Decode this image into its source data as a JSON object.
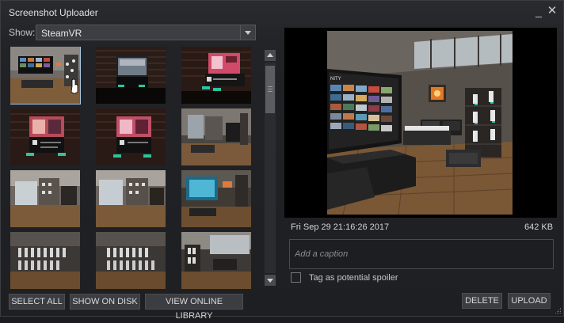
{
  "window": {
    "title": "Screenshot Uploader",
    "minimize_glyph": "_",
    "close_glyph": "✕"
  },
  "filter": {
    "label": "Show:",
    "selected": "SteamVR"
  },
  "buttons": {
    "select_all": "SELECT ALL",
    "show_on_disk": "SHOW ON DISK",
    "view_online_library": "VIEW ONLINE LIBRARY",
    "delete": "DELETE",
    "upload": "UPLOAD"
  },
  "details": {
    "date": "Fri Sep 29 21:16:26 2017",
    "size": "642 KB",
    "caption_placeholder": "Add a caption",
    "spoiler_label": "Tag as potential spoiler"
  },
  "icons": [
    "hand-cursor-icon",
    "scroll-up-arrow-icon",
    "scroll-down-arrow-icon",
    "dropdown-arrow-icon",
    "resize-grip-icon"
  ],
  "thumbnails": [
    {
      "scene": "vr-home-trophy-room",
      "selected": true
    },
    {
      "scene": "vr-brick-room-screen"
    },
    {
      "scene": "vr-brick-room-menu-screen"
    },
    {
      "scene": "vr-brick-room-game-screen"
    },
    {
      "scene": "vr-brick-room-game-screen-2"
    },
    {
      "scene": "vr-loft-view"
    },
    {
      "scene": "vr-loft-shelves"
    },
    {
      "scene": "vr-loft-shelves-2"
    },
    {
      "scene": "vr-loft-tv"
    },
    {
      "scene": "vr-trophy-wall"
    },
    {
      "scene": "vr-trophy-wall-2"
    },
    {
      "scene": "vr-window-room"
    }
  ]
}
